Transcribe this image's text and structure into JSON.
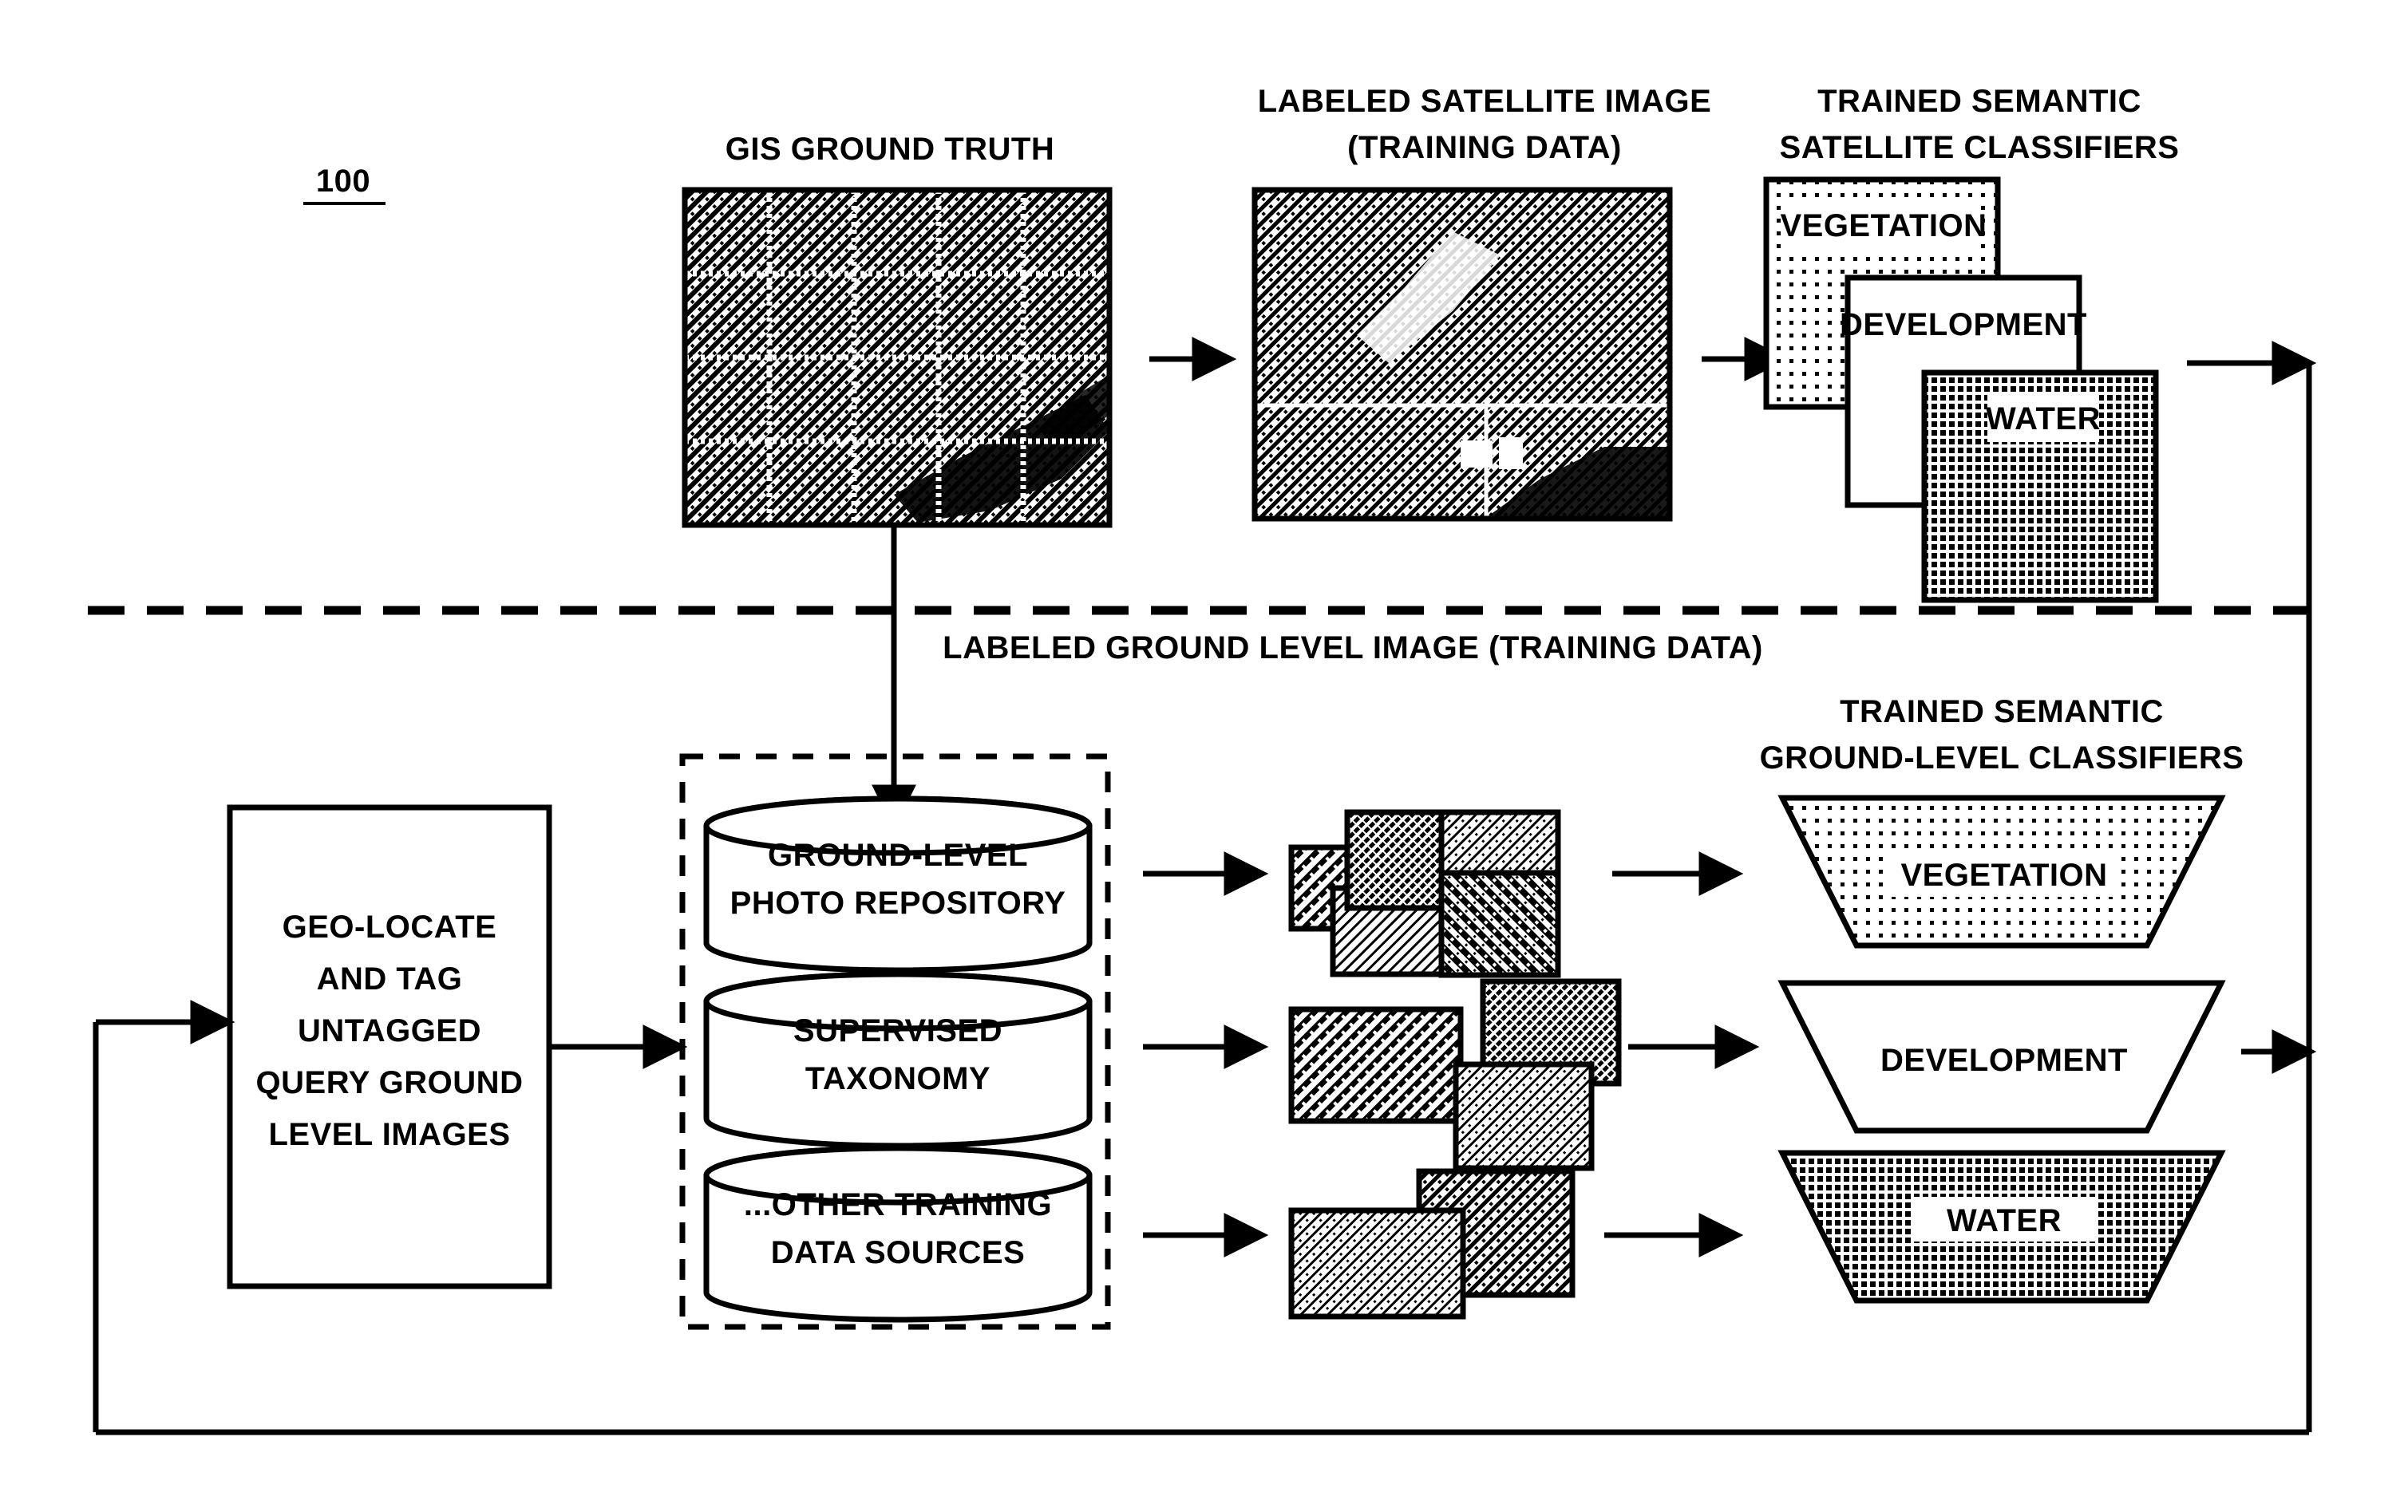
{
  "figure": {
    "reference_numeral": "100",
    "top_section": {
      "gis_title": "GIS GROUND TRUTH",
      "labeled_satellite_title_line1": "LABELED SATELLITE IMAGE",
      "labeled_satellite_title_line2": "(TRAINING DATA)",
      "satellite_classifiers_title_line1": "TRAINED SEMANTIC",
      "satellite_classifiers_title_line2": "SATELLITE CLASSIFIERS",
      "classifiers": [
        {
          "label": "VEGETATION",
          "fill": "stipple-light"
        },
        {
          "label": "DEVELOPMENT",
          "fill": "none"
        },
        {
          "label": "WATER",
          "fill": "grid-dark"
        }
      ]
    },
    "divider_label": "LABELED GROUND LEVEL IMAGE (TRAINING DATA)",
    "bottom_section": {
      "geo_locate_box": {
        "line1": "GEO-LOCATE",
        "line2": "AND TAG",
        "line3": "UNTAGGED",
        "line4": "QUERY GROUND",
        "line5": "LEVEL IMAGES"
      },
      "repositories": [
        {
          "line1": "GROUND-LEVEL",
          "line2": "PHOTO REPOSITORY"
        },
        {
          "line1": "SUPERVISED",
          "line2": "TAXONOMY"
        },
        {
          "line1": "...OTHER TRAINING",
          "line2": "DATA SOURCES"
        }
      ],
      "ground_classifiers_title_line1": "TRAINED SEMANTIC",
      "ground_classifiers_title_line2": "GROUND-LEVEL CLASSIFIERS",
      "classifiers": [
        {
          "label": "VEGETATION",
          "fill": "stipple-light"
        },
        {
          "label": "DEVELOPMENT",
          "fill": "none"
        },
        {
          "label": "WATER",
          "fill": "grid-dark"
        }
      ]
    },
    "colors": {
      "ink": "#000000",
      "paper": "#ffffff"
    }
  }
}
